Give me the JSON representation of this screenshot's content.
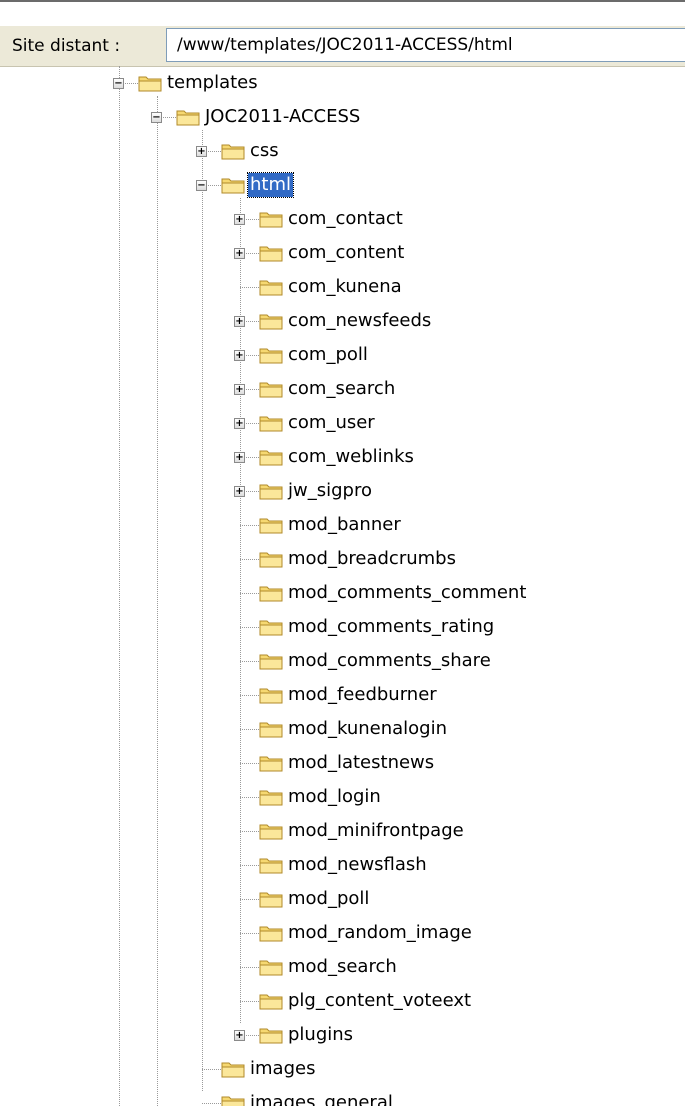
{
  "address": {
    "label": "Site distant :",
    "value": "/www/templates/JOC2011-ACCESS/html"
  },
  "colors": {
    "selection": "#316ac5",
    "folder": "#f6d871",
    "background": "#ffffff"
  },
  "tree": [
    {
      "label": "templates",
      "level": 0,
      "expander": "minus"
    },
    {
      "label": "JOC2011-ACCESS",
      "level": 1,
      "expander": "minus"
    },
    {
      "label": "css",
      "level": 2,
      "expander": "plus"
    },
    {
      "label": "html",
      "level": 2,
      "expander": "minus",
      "selected": true
    },
    {
      "label": "com_contact",
      "level": 3,
      "expander": "plus"
    },
    {
      "label": "com_content",
      "level": 3,
      "expander": "plus"
    },
    {
      "label": "com_kunena",
      "level": 3,
      "expander": "none"
    },
    {
      "label": "com_newsfeeds",
      "level": 3,
      "expander": "plus"
    },
    {
      "label": "com_poll",
      "level": 3,
      "expander": "plus"
    },
    {
      "label": "com_search",
      "level": 3,
      "expander": "plus"
    },
    {
      "label": "com_user",
      "level": 3,
      "expander": "plus"
    },
    {
      "label": "com_weblinks",
      "level": 3,
      "expander": "plus"
    },
    {
      "label": "jw_sigpro",
      "level": 3,
      "expander": "plus"
    },
    {
      "label": "mod_banner",
      "level": 3,
      "expander": "none"
    },
    {
      "label": "mod_breadcrumbs",
      "level": 3,
      "expander": "none"
    },
    {
      "label": "mod_comments_comment",
      "level": 3,
      "expander": "none"
    },
    {
      "label": "mod_comments_rating",
      "level": 3,
      "expander": "none"
    },
    {
      "label": "mod_comments_share",
      "level": 3,
      "expander": "none"
    },
    {
      "label": "mod_feedburner",
      "level": 3,
      "expander": "none"
    },
    {
      "label": "mod_kunenalogin",
      "level": 3,
      "expander": "none"
    },
    {
      "label": "mod_latestnews",
      "level": 3,
      "expander": "none"
    },
    {
      "label": "mod_login",
      "level": 3,
      "expander": "none"
    },
    {
      "label": "mod_minifrontpage",
      "level": 3,
      "expander": "none"
    },
    {
      "label": "mod_newsflash",
      "level": 3,
      "expander": "none"
    },
    {
      "label": "mod_poll",
      "level": 3,
      "expander": "none"
    },
    {
      "label": "mod_random_image",
      "level": 3,
      "expander": "none"
    },
    {
      "label": "mod_search",
      "level": 3,
      "expander": "none"
    },
    {
      "label": "plg_content_voteext",
      "level": 3,
      "expander": "none"
    },
    {
      "label": "plugins",
      "level": 3,
      "expander": "plus"
    },
    {
      "label": "images",
      "level": 2,
      "expander": "none"
    },
    {
      "label": "images_general",
      "level": 2,
      "expander": "none"
    }
  ]
}
